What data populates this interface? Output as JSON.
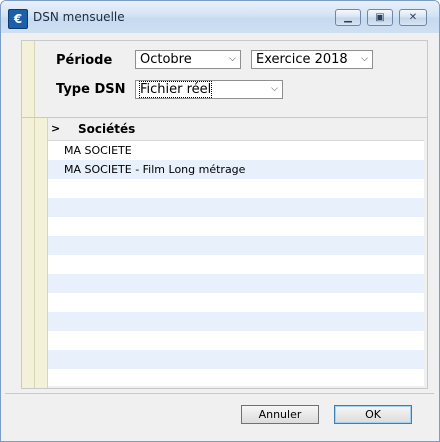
{
  "window": {
    "title": "DSN mensuelle"
  },
  "filters": {
    "periode_label": "Période",
    "periode_value": "Octobre",
    "exercice_value": "Exercice 2018",
    "type_label": "Type DSN",
    "type_value": "Fichier réel"
  },
  "list": {
    "expander": ">",
    "header": "Sociétés",
    "rows": [
      "MA SOCIETE",
      "MA SOCIETE - Film Long métrage",
      "",
      "",
      "",
      "",
      "",
      "",
      "",
      "",
      "",
      "",
      ""
    ]
  },
  "buttons": {
    "cancel": "Annuler",
    "ok": "OK"
  },
  "icons": {
    "app": "app-icon",
    "minimize": "minimize-icon",
    "maximize": "maximize-icon",
    "close": "close-icon",
    "dropdown": "chevron-down-icon"
  }
}
